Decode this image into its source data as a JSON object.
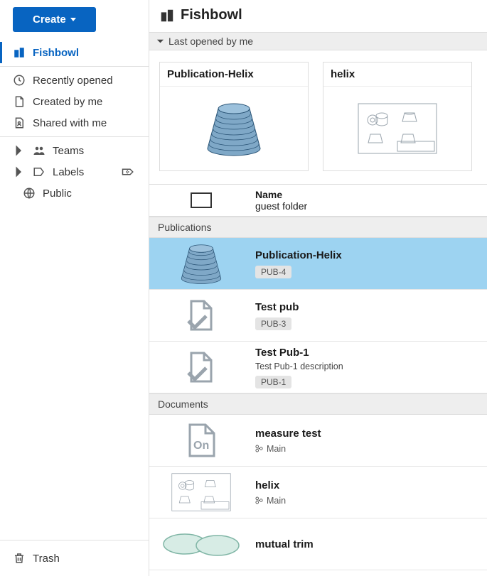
{
  "create_label": "Create",
  "workspace_title": "Fishbowl",
  "sidebar": {
    "fishbowl": "Fishbowl",
    "recently_opened": "Recently opened",
    "created_by_me": "Created by me",
    "shared_with_me": "Shared with me",
    "teams": "Teams",
    "labels": "Labels",
    "public": "Public",
    "trash": "Trash"
  },
  "sections": {
    "last_opened": "Last opened by me",
    "publications": "Publications",
    "documents": "Documents"
  },
  "cards": [
    {
      "title": "Publication-Helix"
    },
    {
      "title": "helix"
    }
  ],
  "name_header": {
    "label": "Name",
    "folder": "guest folder"
  },
  "publications": [
    {
      "title": "Publication-Helix",
      "badge": "PUB-4",
      "selected": true,
      "thumb": "helix"
    },
    {
      "title": "Test pub",
      "badge": "PUB-3",
      "selected": false,
      "thumb": "doc"
    },
    {
      "title": "Test Pub-1",
      "badge": "PUB-1",
      "selected": false,
      "thumb": "doc",
      "desc": "Test Pub-1 description"
    }
  ],
  "documents": [
    {
      "title": "measure test",
      "branch": "Main",
      "thumb": "on"
    },
    {
      "title": "helix",
      "branch": "Main",
      "thumb": "drawing"
    },
    {
      "title": "mutual trim",
      "branch": "",
      "thumb": "ellipse"
    }
  ]
}
